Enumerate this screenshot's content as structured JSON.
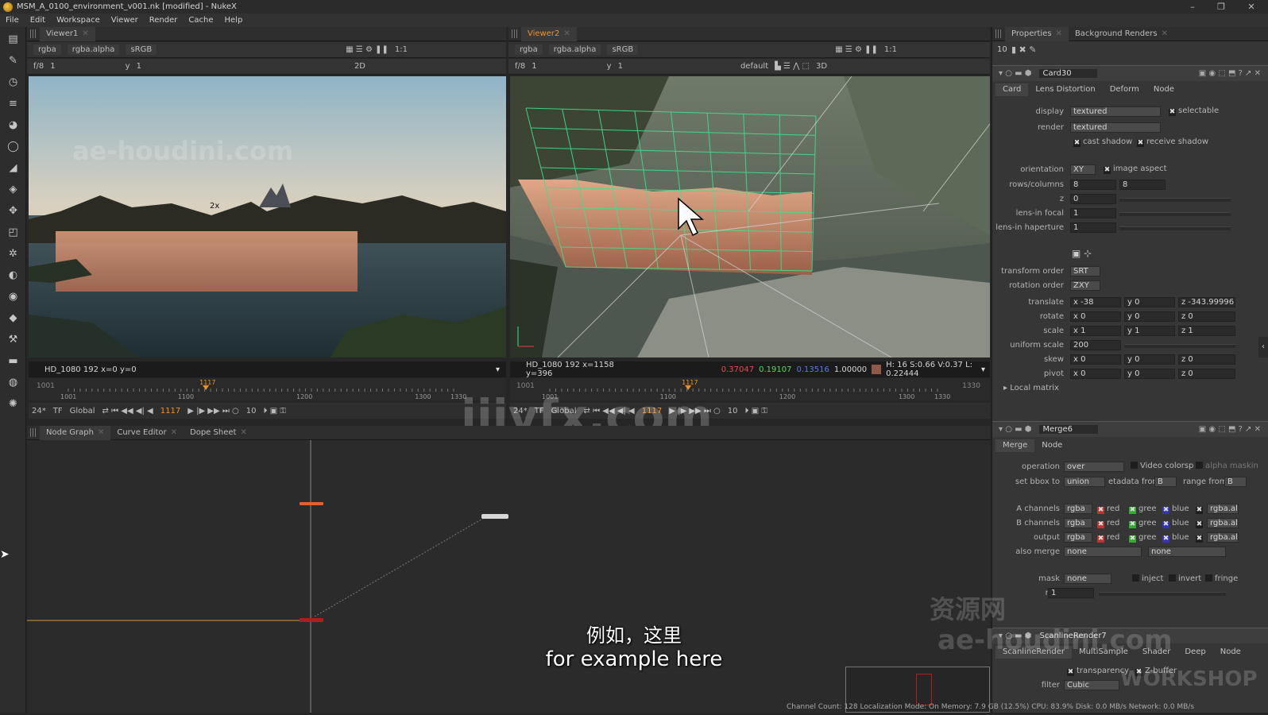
{
  "window": {
    "title": "MSM_A_0100_environment_v001.nk [modified] - NukeX",
    "minimize": "–",
    "maximize": "❐",
    "close": "✕"
  },
  "menu": [
    "File",
    "Edit",
    "Workspace",
    "Viewer",
    "Render",
    "Cache",
    "Help"
  ],
  "viewer1": {
    "tab": "Viewer1",
    "channels": "rgba",
    "alpha": "rgba.alpha",
    "colorspace": "sRGB",
    "zoom": "1:1",
    "fstop": "f/8",
    "frame_field": "1",
    "y_label": "y",
    "y_value": "1",
    "mode": "2D",
    "info": "HD_1080 192  x=0 y=0",
    "overlay_label": "2x",
    "timeline_in": "1001",
    "timeline_ticks": [
      "1001",
      "1100",
      "1200",
      "1300",
      "1330"
    ],
    "current_frame_marker": "1117",
    "fps": "24*",
    "tf": "TF",
    "global": "Global",
    "frame": "1117",
    "step": "10"
  },
  "viewer2": {
    "tab": "Viewer2",
    "channels": "rgba",
    "alpha": "rgba.alpha",
    "colorspace": "sRGB",
    "zoom": "1:1",
    "fstop": "f/8",
    "frame_field": "1",
    "y_label": "y",
    "y_value": "1",
    "lut": "default",
    "mode": "3D",
    "info": "HD_1080 192  x=1158 y=396",
    "r": "0.37047",
    "g": "0.19107",
    "b": "0.13516",
    "a": "1.00000",
    "hsvl": "H: 16 S:0.66 V:0.37  L: 0.22444",
    "timeline_in": "1001",
    "timeline_ticks": [
      "1001",
      "1100",
      "1200",
      "1300",
      "1330"
    ],
    "timeline_out": "1330",
    "current_frame_marker": "1117",
    "fps": "24*",
    "tf": "TF",
    "global": "Global",
    "frame": "1117",
    "step": "10"
  },
  "bottom_tabs": [
    "Node Graph",
    "Curve Editor",
    "Dope Sheet"
  ],
  "properties": {
    "tabs": [
      "Properties",
      "Background Renders"
    ],
    "max_panels": "10",
    "card": {
      "name": "Card30",
      "tabs": [
        "Card",
        "Lens Distortion",
        "Deform",
        "Node"
      ],
      "display_label": "display",
      "display": "textured",
      "selectable": "selectable",
      "render_label": "render",
      "render": "textured",
      "cast_shadow": "cast shadow",
      "receive_shadow": "receive shadow",
      "orientation_label": "orientation",
      "orientation": "XY",
      "image_aspect": "image aspect",
      "rows_columns_label": "rows/columns",
      "rows": "8",
      "columns": "8",
      "z_label": "z",
      "z": "0",
      "lens_focal_label": "lens-in focal",
      "lens_focal": "1",
      "lens_haperture_label": "lens-in haperture",
      "lens_haperture": "1",
      "transform_order_label": "transform order",
      "transform_order": "SRT",
      "rotation_order_label": "rotation order",
      "rotation_order": "ZXY",
      "translate_label": "translate",
      "translate": [
        "x -38",
        "y 0",
        "z -343.99996"
      ],
      "rotate_label": "rotate",
      "rotate": [
        "x 0",
        "y 0",
        "z 0"
      ],
      "scale_label": "scale",
      "scale": [
        "x 1",
        "y 1",
        "z 1"
      ],
      "uniform_scale_label": "uniform scale",
      "uniform_scale": "200",
      "skew_label": "skew",
      "skew": [
        "x 0",
        "y 0",
        "z 0"
      ],
      "pivot_label": "pivot",
      "pivot": [
        "x 0",
        "y 0",
        "z 0"
      ],
      "local_matrix": "Local matrix"
    },
    "merge": {
      "name": "Merge6",
      "tabs": [
        "Merge",
        "Node"
      ],
      "operation_label": "operation",
      "operation": "over",
      "video_colorspace": "Video colorsp",
      "alpha_masking": "alpha maskin",
      "set_bbox_label": "set bbox to",
      "set_bbox": "union",
      "metadata_from_label": "etadata from",
      "metadata_from": "B",
      "range_from_label": "range from",
      "range_from": "B",
      "a_channels_label": "A channels",
      "b_channels_label": "B channels",
      "output_label": "output",
      "channels_value": "rgba",
      "red": "red",
      "green": "gree",
      "blue": "blue",
      "alpha_channel": "rgba.al",
      "also_merge_label": "also merge",
      "also_merge": "none",
      "also_merge2": "none",
      "mask_label": "mask",
      "mask": "none",
      "inject": "inject",
      "invert": "invert",
      "fringe": "fringe",
      "mix_label": "mix",
      "mix": "1"
    },
    "scanline": {
      "name": "ScanlineRender7",
      "tabs": [
        "ScanlineRender",
        "MultiSample",
        "Shader",
        "Deep",
        "Node"
      ],
      "transparency": "transparency",
      "zbuffer": "Z-buffer",
      "filter_label": "filter",
      "filter": "Cubic"
    }
  },
  "subtitles": {
    "zh": "例如，这里",
    "en": "for example here"
  },
  "watermarks": {
    "center": "iiivfx.com",
    "viewer1": "ae-houdini.com",
    "cn": "资源网",
    "props": "ae-houdini.com",
    "workshop": "WORKSHOP"
  },
  "status": "Channel Count: 128  Localization Mode: On  Memory: 7.9 GB (12.5%)  CPU: 83.9%  Disk: 0.0 MB/s  Network: 0.0 MB/s",
  "colors": {
    "accent": "#f0922a",
    "grid": "#35e08a",
    "node_orange": "#e2612d",
    "node_red": "#b11c1c"
  }
}
